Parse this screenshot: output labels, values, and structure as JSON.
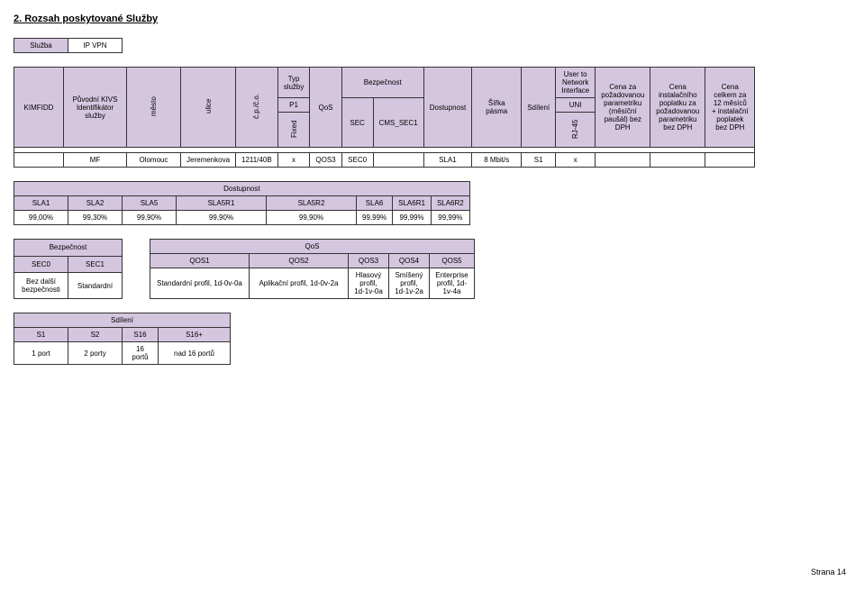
{
  "section_title": "2. Rozsah poskytované Služby",
  "table1": {
    "h_sluzba": "Služba",
    "v_sluzba": "IP VPN"
  },
  "main": {
    "h_kimfidd": "KIMFIDD",
    "h_puvodni": "Původní KIVS Identifikátor služby",
    "h_mesto": "město",
    "h_ulice": "ulice",
    "h_cp": "č.p./č.o.",
    "h_typ": "Typ služby",
    "h_p1": "P1",
    "h_fixed": "Fixed",
    "h_qos": "QoS",
    "h_bezp": "Bezpečnost",
    "h_sec": "SEC",
    "h_cms": "CMS_SEC1",
    "h_dost": "Dostupnost",
    "h_sirka": "Šířka pásma",
    "h_sdil": "Sdílení",
    "h_user": "User to Network Interface",
    "h_uni": "UNI",
    "h_rj45": "RJ-45",
    "h_cena1": "Cena za požadovanou parametriku (měsíční paušál) bez DPH",
    "h_cena2": "Cena instalačního poplatku za požadovanou parametriku bez DPH",
    "h_cena3": "Cena celkem za 12 měsíců + instalační poplatek bez DPH",
    "row": {
      "c1": "MF",
      "c2": "Olomouc",
      "c3": "Jeremenkova",
      "c4": "1211/40B",
      "c5": "x",
      "c6": "QOS3",
      "c7": "SEC0",
      "c8": "SLA1",
      "c9": "8 Mbit/s",
      "c10": "S1",
      "c11": "x"
    }
  },
  "dost": {
    "title": "Dostupnost",
    "h": [
      "SLA1",
      "SLA2",
      "SLA5",
      "SLA5R1",
      "SLA5R2",
      "SLA6",
      "SLA6R1",
      "SLA6R2"
    ],
    "v": [
      "99,00%",
      "99,30%",
      "99,90%",
      "99,90%",
      "99,90%",
      "99,99%",
      "99,99%",
      "99,99%"
    ]
  },
  "bezp": {
    "title": "Bezpečnost",
    "h": [
      "SEC0",
      "SEC1"
    ],
    "v": [
      "Bez další bezpečnosti",
      "Standardní"
    ]
  },
  "qos": {
    "title": "QoS",
    "h": [
      "QOS1",
      "QOS2",
      "QOS3",
      "QOS4",
      "QOS5"
    ],
    "v": [
      "Standardní profil, 1d-0v-0a",
      "Aplikační profil, 1d-0v-2a",
      "Hlasový profil, 1d-1v-0a",
      "Smíšený profil, 1d-1v-2a",
      "Enterprise profil, 1d-1v-4a"
    ]
  },
  "sdil": {
    "title": "Sdílení",
    "h": [
      "S1",
      "S2",
      "S16",
      "S16+"
    ],
    "v": [
      "1 port",
      "2 porty",
      "16 portů",
      "nad 16 portů"
    ]
  },
  "footer": "Strana 14"
}
